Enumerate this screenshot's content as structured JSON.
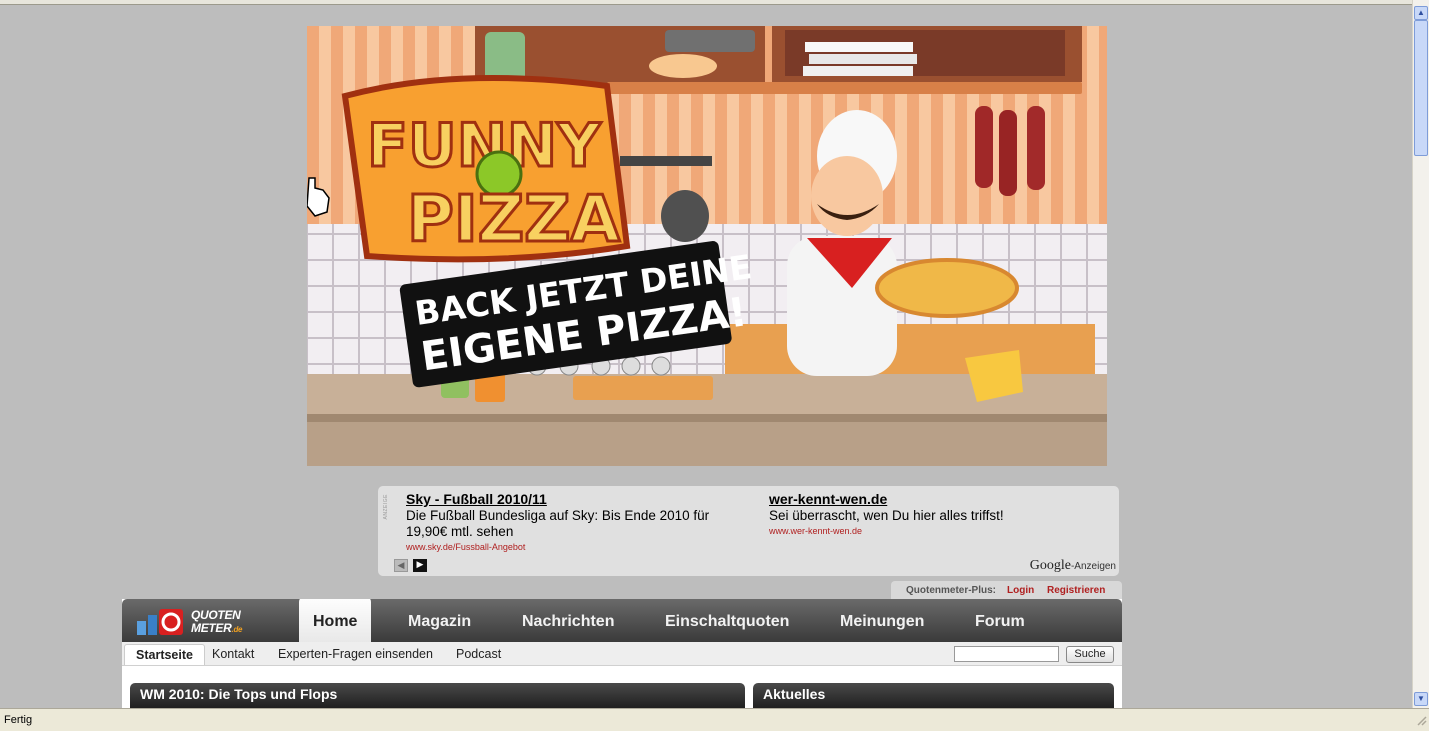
{
  "status": {
    "text": "Fertig"
  },
  "banner": {
    "logo_line1": "FUNNY",
    "logo_line2": "PIZZA",
    "slogan_line1": "BACK JETZT DEINE",
    "slogan_line2": "EIGENE PIZZA!"
  },
  "ads": {
    "label": "ANZEIGE",
    "items": [
      {
        "title": "Sky - Fußball 2010/11",
        "desc": "Die Fußball Bundesliga auf Sky: Bis Ende 2010 für 19,90€ mtl. sehen",
        "url": "www.sky.de/Fussball-Angebot"
      },
      {
        "title": "wer-kennt-wen.de",
        "desc": "Sei überrascht, wen Du hier alles triffst!",
        "url": "www.wer-kennt-wen.de"
      }
    ],
    "google_brand": "Google",
    "google_suffix": "-Anzeigen"
  },
  "plus": {
    "label": "Quotenmeter-Plus:",
    "login": "Login",
    "register": "Registrieren"
  },
  "logo": {
    "line1": "QUOTEN",
    "line2": "METER",
    "tld": ".de"
  },
  "nav": {
    "items": [
      "Home",
      "Magazin",
      "Nachrichten",
      "Einschaltquoten",
      "Meinungen",
      "Forum"
    ]
  },
  "subnav": {
    "items": [
      "Startseite",
      "Kontakt",
      "Experten-Fragen einsenden",
      "Podcast"
    ],
    "search_button": "Suche"
  },
  "boxes": {
    "left_title": "WM 2010: Die Tops und Flops",
    "right_title": "Aktuelles"
  },
  "colors": {
    "accent_red": "#b02020",
    "nav_dark": "#3a3a3a",
    "page_bg": "#bdbdbd"
  }
}
